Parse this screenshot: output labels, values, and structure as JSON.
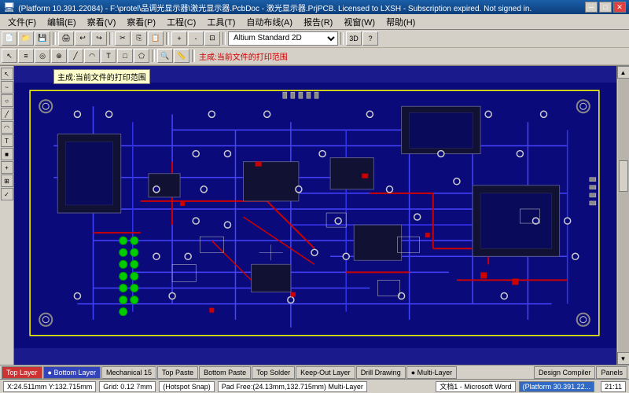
{
  "titleBar": {
    "text": "(Platform 10.391.22084) - F:\\protel\\品调光显示器\\激光显示器.PcbDoc - 激光显示器.PrjPCB. Licensed to LXSH - Subscription expired. Not signed in."
  },
  "menuBar": {
    "items": [
      "文件(F)",
      "编辑(E)",
      "察看(V)",
      "察看(P)",
      "工程(C)",
      "工具(T)",
      "自动布线(A)",
      "报告(R)",
      "视窗(W)",
      "帮助(H)"
    ]
  },
  "toolbar": {
    "viewSelector": "Altium Standard 2D",
    "tooltip": "主成:当前文件的打印范围"
  },
  "layers": {
    "tabs": [
      {
        "label": "Top Layer",
        "color": "#cc0000"
      },
      {
        "label": "● Bottom Layer",
        "color": "#0000cc"
      },
      {
        "label": "Mechanical 15",
        "color": "#ffff00"
      },
      {
        "label": "Top Paste",
        "color": "#808080"
      },
      {
        "label": "Bottom Paste",
        "color": "#808080"
      },
      {
        "label": "Top Solder",
        "color": "#808080"
      },
      {
        "label": "Keep-Out Layer",
        "color": "#ff00ff"
      },
      {
        "label": "Drill Drawing",
        "color": "#808080"
      },
      {
        "label": "● Multi-Layer",
        "color": "#808080"
      }
    ]
  },
  "statusBar": {
    "coords": "X:24.511mm Y:132.715mm",
    "grid": "Grid: 0.12 7mm",
    "snap": "(Hotspot Snap)",
    "pad": "Pad Free:(24.13mm,132.715mm) Multi-Layer",
    "platform": "(Platform 30.391.220...",
    "taskItems": [
      "文档1 - Microsoft Word",
      "(Platform 30.391.22..."
    ]
  },
  "icons": {
    "arrow": "▶",
    "up": "▲",
    "down": "▼",
    "left": "◀",
    "right": "▶",
    "close": "✕",
    "minimize": "─",
    "maximize": "□",
    "zoomIn": "+",
    "zoomOut": "-",
    "pointer": "↖",
    "hand": "✋",
    "zoom": "🔍",
    "route": "≡",
    "pen": "✎",
    "circle": "○",
    "box": "□",
    "line": "╱",
    "move": "✥",
    "text": "T",
    "pad": "⊕",
    "via": "◎"
  },
  "windowControls": {
    "minimize": "─",
    "maximize": "□",
    "close": "✕"
  }
}
